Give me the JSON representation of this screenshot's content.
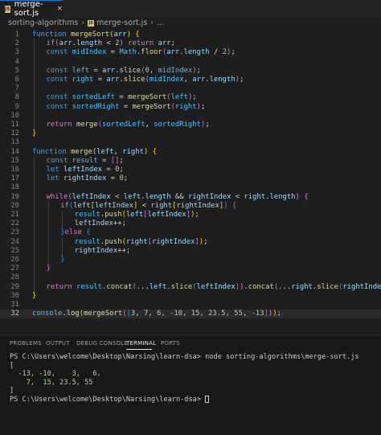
{
  "tab": {
    "icon": "JS",
    "label": "merge-sort.js",
    "close": "×"
  },
  "breadcrumb": {
    "folder": "sorting-algorithms",
    "sep": "›",
    "file": "merge-sort.js",
    "sep2": "›",
    "more": "..."
  },
  "editor": {
    "active_line": 32,
    "lines": [
      {
        "n": "1",
        "i": 0,
        "t": [
          [
            "kw",
            "function "
          ],
          [
            "fn",
            "mergeSort"
          ],
          [
            "b1",
            "("
          ],
          [
            "vr",
            "arr"
          ],
          [
            "b1",
            ")"
          ],
          [
            "pn",
            " "
          ],
          [
            "b1",
            "{"
          ]
        ]
      },
      {
        "n": "2",
        "i": 1,
        "t": [
          [
            "ctl",
            "if"
          ],
          [
            "b2",
            "("
          ],
          [
            "vr",
            "arr"
          ],
          [
            "pn",
            "."
          ],
          [
            "vr",
            "length"
          ],
          [
            "pn",
            " < "
          ],
          [
            "nm",
            "2"
          ],
          [
            "b2",
            ")"
          ],
          [
            "pn",
            " "
          ],
          [
            "ctl",
            "return"
          ],
          [
            "pn",
            " "
          ],
          [
            "vr",
            "arr"
          ],
          [
            "pn",
            ";"
          ]
        ]
      },
      {
        "n": "3",
        "i": 1,
        "t": [
          [
            "kw",
            "const "
          ],
          [
            "cn",
            "midIndex"
          ],
          [
            "pn",
            " = "
          ],
          [
            "cn",
            "Math"
          ],
          [
            "pn",
            "."
          ],
          [
            "fn",
            "floor"
          ],
          [
            "b2",
            "("
          ],
          [
            "vr",
            "arr"
          ],
          [
            "pn",
            "."
          ],
          [
            "vr",
            "length"
          ],
          [
            "pn",
            " / "
          ],
          [
            "nm",
            "2"
          ],
          [
            "b2",
            ")"
          ],
          [
            "pn",
            ";"
          ]
        ]
      },
      {
        "n": "4",
        "i": 1,
        "t": []
      },
      {
        "n": "5",
        "i": 1,
        "t": [
          [
            "kw",
            "const "
          ],
          [
            "cn",
            "left"
          ],
          [
            "pn",
            " = "
          ],
          [
            "vr",
            "arr"
          ],
          [
            "pn",
            "."
          ],
          [
            "fn",
            "slice"
          ],
          [
            "b2",
            "("
          ],
          [
            "nm",
            "0"
          ],
          [
            "pn",
            ", "
          ],
          [
            "cn",
            "midIndex"
          ],
          [
            "b2",
            ")"
          ],
          [
            "pn",
            ";"
          ]
        ]
      },
      {
        "n": "6",
        "i": 1,
        "t": [
          [
            "kw",
            "const "
          ],
          [
            "cn",
            "right"
          ],
          [
            "pn",
            " = "
          ],
          [
            "vr",
            "arr"
          ],
          [
            "pn",
            "."
          ],
          [
            "fn",
            "slice"
          ],
          [
            "b2",
            "("
          ],
          [
            "cn",
            "midIndex"
          ],
          [
            "pn",
            ", "
          ],
          [
            "vr",
            "arr"
          ],
          [
            "pn",
            "."
          ],
          [
            "vr",
            "length"
          ],
          [
            "b2",
            ")"
          ],
          [
            "pn",
            ";"
          ]
        ]
      },
      {
        "n": "7",
        "i": 1,
        "t": []
      },
      {
        "n": "8",
        "i": 1,
        "t": [
          [
            "kw",
            "const "
          ],
          [
            "cn",
            "sortedLeft"
          ],
          [
            "pn",
            " = "
          ],
          [
            "fn",
            "mergeSort"
          ],
          [
            "b2",
            "("
          ],
          [
            "cn",
            "left"
          ],
          [
            "b2",
            ")"
          ],
          [
            "pn",
            ";"
          ]
        ]
      },
      {
        "n": "9",
        "i": 1,
        "t": [
          [
            "kw",
            "const "
          ],
          [
            "cn",
            "sortedRight"
          ],
          [
            "pn",
            " = "
          ],
          [
            "fn",
            "mergeSort"
          ],
          [
            "b2",
            "("
          ],
          [
            "cn",
            "right"
          ],
          [
            "b2",
            ")"
          ],
          [
            "pn",
            ";"
          ]
        ]
      },
      {
        "n": "10",
        "i": 1,
        "t": []
      },
      {
        "n": "11",
        "i": 1,
        "t": [
          [
            "ctl",
            "return"
          ],
          [
            "pn",
            " "
          ],
          [
            "fn",
            "merge"
          ],
          [
            "b2",
            "("
          ],
          [
            "cn",
            "sortedLeft"
          ],
          [
            "pn",
            ", "
          ],
          [
            "cn",
            "sortedRight"
          ],
          [
            "b2",
            ")"
          ],
          [
            "pn",
            ";"
          ]
        ]
      },
      {
        "n": "12",
        "i": 0,
        "t": [
          [
            "b1",
            "}"
          ]
        ]
      },
      {
        "n": "13",
        "i": 0,
        "t": []
      },
      {
        "n": "14",
        "i": 0,
        "t": [
          [
            "kw",
            "function "
          ],
          [
            "fn",
            "merge"
          ],
          [
            "b1",
            "("
          ],
          [
            "vr",
            "left"
          ],
          [
            "pn",
            ", "
          ],
          [
            "vr",
            "right"
          ],
          [
            "b1",
            ")"
          ],
          [
            "pn",
            " "
          ],
          [
            "b1",
            "{"
          ]
        ]
      },
      {
        "n": "15",
        "i": 1,
        "t": [
          [
            "kw",
            "const "
          ],
          [
            "cn",
            "result"
          ],
          [
            "pn",
            " = "
          ],
          [
            "b2",
            "[]"
          ],
          [
            "pn",
            ";"
          ]
        ]
      },
      {
        "n": "16",
        "i": 1,
        "t": [
          [
            "kw",
            "let "
          ],
          [
            "vr",
            "leftIndex"
          ],
          [
            "pn",
            " = "
          ],
          [
            "nm",
            "0"
          ],
          [
            "pn",
            ";"
          ]
        ]
      },
      {
        "n": "17",
        "i": 1,
        "t": [
          [
            "kw",
            "let "
          ],
          [
            "vr",
            "rightIndex"
          ],
          [
            "pn",
            " = "
          ],
          [
            "nm",
            "0"
          ],
          [
            "pn",
            ";"
          ]
        ]
      },
      {
        "n": "18",
        "i": 1,
        "t": []
      },
      {
        "n": "19",
        "i": 1,
        "t": [
          [
            "ctl",
            "while"
          ],
          [
            "b2",
            "("
          ],
          [
            "vr",
            "leftIndex"
          ],
          [
            "pn",
            " < "
          ],
          [
            "vr",
            "left"
          ],
          [
            "pn",
            "."
          ],
          [
            "vr",
            "length"
          ],
          [
            "pn",
            " && "
          ],
          [
            "vr",
            "rightIndex"
          ],
          [
            "pn",
            " < "
          ],
          [
            "vr",
            "right"
          ],
          [
            "pn",
            "."
          ],
          [
            "vr",
            "length"
          ],
          [
            "b2",
            ")"
          ],
          [
            "pn",
            " "
          ],
          [
            "b2",
            "{"
          ]
        ]
      },
      {
        "n": "20",
        "i": 2,
        "t": [
          [
            "ctl",
            "if"
          ],
          [
            "b3",
            "("
          ],
          [
            "vr",
            "left"
          ],
          [
            "b1",
            "["
          ],
          [
            "vr",
            "leftIndex"
          ],
          [
            "b1",
            "]"
          ],
          [
            "pn",
            " < "
          ],
          [
            "vr",
            "right"
          ],
          [
            "b1",
            "["
          ],
          [
            "vr",
            "rightIndex"
          ],
          [
            "b1",
            "]"
          ],
          [
            "b3",
            ")"
          ],
          [
            "pn",
            " "
          ],
          [
            "b3",
            "{"
          ]
        ]
      },
      {
        "n": "21",
        "i": 3,
        "t": [
          [
            "cn",
            "result"
          ],
          [
            "pn",
            "."
          ],
          [
            "fn",
            "push"
          ],
          [
            "b1",
            "("
          ],
          [
            "vr",
            "left"
          ],
          [
            "b2",
            "["
          ],
          [
            "vr",
            "leftIndex"
          ],
          [
            "b2",
            "]"
          ],
          [
            "b1",
            ")"
          ],
          [
            "pn",
            ";"
          ]
        ]
      },
      {
        "n": "22",
        "i": 3,
        "t": [
          [
            "vr",
            "leftIndex"
          ],
          [
            "pn",
            "++;"
          ]
        ]
      },
      {
        "n": "23",
        "i": 2,
        "t": [
          [
            "b3",
            "}"
          ],
          [
            "ctl",
            "else"
          ],
          [
            "pn",
            " "
          ],
          [
            "b3",
            "{"
          ]
        ]
      },
      {
        "n": "24",
        "i": 3,
        "t": [
          [
            "cn",
            "result"
          ],
          [
            "pn",
            "."
          ],
          [
            "fn",
            "push"
          ],
          [
            "b1",
            "("
          ],
          [
            "vr",
            "right"
          ],
          [
            "b2",
            "["
          ],
          [
            "vr",
            "rightIndex"
          ],
          [
            "b2",
            "]"
          ],
          [
            "b1",
            ")"
          ],
          [
            "pn",
            ";"
          ]
        ]
      },
      {
        "n": "25",
        "i": 3,
        "t": [
          [
            "vr",
            "rightIndex"
          ],
          [
            "pn",
            "++;"
          ]
        ]
      },
      {
        "n": "26",
        "i": 2,
        "t": [
          [
            "b3",
            "}"
          ]
        ]
      },
      {
        "n": "27",
        "i": 1,
        "t": [
          [
            "b2",
            "}"
          ]
        ]
      },
      {
        "n": "28",
        "i": 1,
        "t": []
      },
      {
        "n": "29",
        "i": 1,
        "t": [
          [
            "ctl",
            "return"
          ],
          [
            "pn",
            " "
          ],
          [
            "cn",
            "result"
          ],
          [
            "pn",
            "."
          ],
          [
            "fn",
            "concat"
          ],
          [
            "b2",
            "("
          ],
          [
            "pn",
            "..."
          ],
          [
            "vr",
            "left"
          ],
          [
            "pn",
            "."
          ],
          [
            "fn",
            "slice"
          ],
          [
            "b3",
            "("
          ],
          [
            "vr",
            "leftIndex"
          ],
          [
            "b3",
            ")"
          ],
          [
            "b2",
            ")"
          ],
          [
            "pn",
            "."
          ],
          [
            "fn",
            "concat"
          ],
          [
            "b2",
            "("
          ],
          [
            "pn",
            "..."
          ],
          [
            "vr",
            "right"
          ],
          [
            "pn",
            "."
          ],
          [
            "fn",
            "slice"
          ],
          [
            "b3",
            "("
          ],
          [
            "vr",
            "rightIndex"
          ],
          [
            "b3",
            ")"
          ],
          [
            "b2",
            ")"
          ],
          [
            "pn",
            ";"
          ]
        ]
      },
      {
        "n": "30",
        "i": 0,
        "t": [
          [
            "b1",
            "}"
          ]
        ]
      },
      {
        "n": "31",
        "i": 0,
        "t": []
      },
      {
        "n": "32",
        "i": 0,
        "t": [
          [
            "cn",
            "console"
          ],
          [
            "pn",
            "."
          ],
          [
            "fn",
            "log"
          ],
          [
            "b1",
            "("
          ],
          [
            "fn",
            "mergeSort"
          ],
          [
            "b2",
            "("
          ],
          [
            "b3",
            "["
          ],
          [
            "nm",
            "3"
          ],
          [
            "pn",
            ", "
          ],
          [
            "nm",
            "7"
          ],
          [
            "pn",
            ", "
          ],
          [
            "nm",
            "6"
          ],
          [
            "pn",
            ", "
          ],
          [
            "nm",
            "-10"
          ],
          [
            "pn",
            ", "
          ],
          [
            "nm",
            "15"
          ],
          [
            "pn",
            ", "
          ],
          [
            "nm",
            "23.5"
          ],
          [
            "pn",
            ", "
          ],
          [
            "nm",
            "55"
          ],
          [
            "pn",
            ", "
          ],
          [
            "nm",
            "-13"
          ],
          [
            "b3",
            "]"
          ],
          [
            "b2",
            ")"
          ],
          [
            "b1",
            ")"
          ],
          [
            "pn",
            ";"
          ]
        ]
      }
    ]
  },
  "panel": {
    "tabs": [
      {
        "name": "problems",
        "label": "PROBLEMS",
        "active": false
      },
      {
        "name": "output",
        "label": "OUTPUT",
        "active": false
      },
      {
        "name": "debug-console",
        "label": "DEBUG CONSOLE",
        "active": false
      },
      {
        "name": "terminal",
        "label": "TERMINAL",
        "active": true
      },
      {
        "name": "ports",
        "label": "PORTS",
        "active": false
      }
    ],
    "terminal": {
      "lines": [
        "PS C:\\Users\\welcome\\Desktop\\Narsing\\learn-dsa> node sorting-algorithms\\merge-sort.js",
        "[",
        "  -13, -10,    3,   6,",
        "    7,  15, 23.5, 55",
        "]"
      ],
      "prompt": "PS C:\\Users\\welcome\\Desktop\\Narsing\\learn-dsa> "
    }
  }
}
